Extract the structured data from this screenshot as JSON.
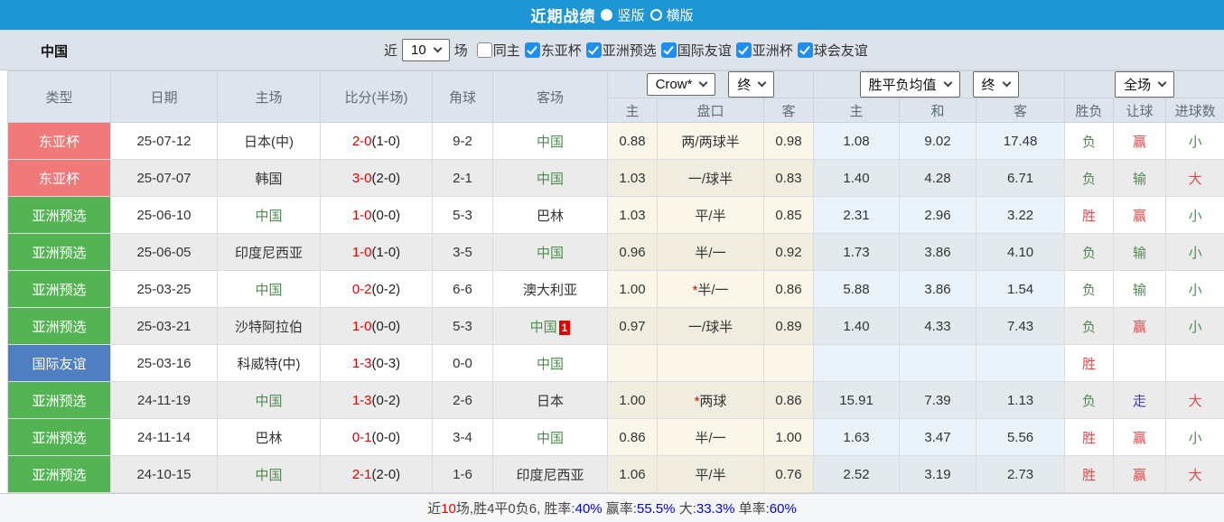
{
  "titlebar": {
    "title": "近期战绩",
    "radios": [
      {
        "label": "竖版",
        "selected": true
      },
      {
        "label": "横版",
        "selected": false
      }
    ]
  },
  "filters": {
    "team": "中国",
    "near_label": "近",
    "count": "10",
    "games_label": "场",
    "checkboxes": [
      {
        "label": "同主",
        "checked": false
      },
      {
        "label": "东亚杯",
        "checked": true
      },
      {
        "label": "亚洲预选",
        "checked": true
      },
      {
        "label": "国际友谊",
        "checked": true
      },
      {
        "label": "亚洲杯",
        "checked": true
      },
      {
        "label": "球会友谊",
        "checked": true
      }
    ]
  },
  "table": {
    "main_headers": [
      "类型",
      "日期",
      "主场",
      "比分(半场)",
      "角球",
      "客场"
    ],
    "sub_headers": [
      "主",
      "盘口",
      "客",
      "主",
      "和",
      "客",
      "胜负",
      "让球",
      "进球数"
    ],
    "selects": {
      "odds_source": "Crow*",
      "odds_time": "终",
      "wdl_avg": "胜平负均值",
      "wdl_time": "终",
      "scope": "全场"
    },
    "rows": [
      {
        "league": "东亚杯",
        "league_color": "red",
        "date": "25-07-12",
        "home": "日本(中)",
        "home_hl": false,
        "score": "2-0",
        "half": "(1-0)",
        "corners": "9-2",
        "away": "中国",
        "away_hl": true,
        "away_badge": "",
        "az_home": "0.88",
        "handicap_star": false,
        "handicap": "两/两球半",
        "az_away": "0.98",
        "eu_home": "1.08",
        "eu_draw": "9.02",
        "eu_away": "17.48",
        "result": {
          "text": "负",
          "color": "green"
        },
        "handicap_result": {
          "text": "赢",
          "color": "red"
        },
        "goals": {
          "text": "小",
          "color": "green"
        }
      },
      {
        "league": "东亚杯",
        "league_color": "red",
        "date": "25-07-07",
        "home": "韩国",
        "home_hl": false,
        "score": "3-0",
        "half": "(2-0)",
        "corners": "2-1",
        "away": "中国",
        "away_hl": true,
        "away_badge": "",
        "az_home": "1.03",
        "handicap_star": false,
        "handicap": "一/球半",
        "az_away": "0.83",
        "eu_home": "1.40",
        "eu_draw": "4.28",
        "eu_away": "6.71",
        "result": {
          "text": "负",
          "color": "green"
        },
        "handicap_result": {
          "text": "输",
          "color": "green"
        },
        "goals": {
          "text": "大",
          "color": "red"
        }
      },
      {
        "league": "亚洲预选",
        "league_color": "green",
        "date": "25-06-10",
        "home": "中国",
        "home_hl": true,
        "score": "1-0",
        "half": "(0-0)",
        "corners": "5-3",
        "away": "巴林",
        "away_hl": false,
        "away_badge": "",
        "az_home": "1.03",
        "handicap_star": false,
        "handicap": "平/半",
        "az_away": "0.85",
        "eu_home": "2.31",
        "eu_draw": "2.96",
        "eu_away": "3.22",
        "result": {
          "text": "胜",
          "color": "red"
        },
        "handicap_result": {
          "text": "赢",
          "color": "red"
        },
        "goals": {
          "text": "小",
          "color": "green"
        }
      },
      {
        "league": "亚洲预选",
        "league_color": "green",
        "date": "25-06-05",
        "home": "印度尼西亚",
        "home_hl": false,
        "score": "1-0",
        "half": "(1-0)",
        "corners": "3-5",
        "away": "中国",
        "away_hl": true,
        "away_badge": "",
        "az_home": "0.96",
        "handicap_star": false,
        "handicap": "半/一",
        "az_away": "0.92",
        "eu_home": "1.73",
        "eu_draw": "3.86",
        "eu_away": "4.10",
        "result": {
          "text": "负",
          "color": "green"
        },
        "handicap_result": {
          "text": "输",
          "color": "green"
        },
        "goals": {
          "text": "小",
          "color": "green"
        }
      },
      {
        "league": "亚洲预选",
        "league_color": "green",
        "date": "25-03-25",
        "home": "中国",
        "home_hl": true,
        "score": "0-2",
        "half": "(0-2)",
        "corners": "6-6",
        "away": "澳大利亚",
        "away_hl": false,
        "away_badge": "",
        "az_home": "1.00",
        "handicap_star": true,
        "handicap": "半/一",
        "az_away": "0.86",
        "eu_home": "5.88",
        "eu_draw": "3.86",
        "eu_away": "1.54",
        "result": {
          "text": "负",
          "color": "green"
        },
        "handicap_result": {
          "text": "输",
          "color": "green"
        },
        "goals": {
          "text": "小",
          "color": "green"
        }
      },
      {
        "league": "亚洲预选",
        "league_color": "green",
        "date": "25-03-21",
        "home": "沙特阿拉伯",
        "home_hl": false,
        "score": "1-0",
        "half": "(0-0)",
        "corners": "5-3",
        "away": "中国",
        "away_hl": true,
        "away_badge": "1",
        "az_home": "0.97",
        "handicap_star": false,
        "handicap": "一/球半",
        "az_away": "0.89",
        "eu_home": "1.40",
        "eu_draw": "4.33",
        "eu_away": "7.43",
        "result": {
          "text": "负",
          "color": "green"
        },
        "handicap_result": {
          "text": "赢",
          "color": "red"
        },
        "goals": {
          "text": "小",
          "color": "green"
        }
      },
      {
        "league": "国际友谊",
        "league_color": "blue",
        "date": "25-03-16",
        "home": "科威特(中)",
        "home_hl": false,
        "score": "1-3",
        "half": "(0-3)",
        "corners": "0-0",
        "away": "中国",
        "away_hl": true,
        "away_badge": "",
        "az_home": "",
        "handicap_star": false,
        "handicap": "",
        "az_away": "",
        "eu_home": "",
        "eu_draw": "",
        "eu_away": "",
        "result": {
          "text": "胜",
          "color": "red"
        },
        "handicap_result": {
          "text": "",
          "color": "dark"
        },
        "goals": {
          "text": "",
          "color": "dark"
        }
      },
      {
        "league": "亚洲预选",
        "league_color": "green",
        "date": "24-11-19",
        "home": "中国",
        "home_hl": true,
        "score": "1-3",
        "half": "(0-2)",
        "corners": "2-6",
        "away": "日本",
        "away_hl": false,
        "away_badge": "",
        "az_home": "1.00",
        "handicap_star": true,
        "handicap": "两球",
        "az_away": "0.86",
        "eu_home": "15.91",
        "eu_draw": "7.39",
        "eu_away": "1.13",
        "result": {
          "text": "负",
          "color": "green"
        },
        "handicap_result": {
          "text": "走",
          "color": "blue"
        },
        "goals": {
          "text": "大",
          "color": "red"
        }
      },
      {
        "league": "亚洲预选",
        "league_color": "green",
        "date": "24-11-14",
        "home": "巴林",
        "home_hl": false,
        "score": "0-1",
        "half": "(0-0)",
        "corners": "3-4",
        "away": "中国",
        "away_hl": true,
        "away_badge": "",
        "az_home": "0.86",
        "handicap_star": false,
        "handicap": "半/一",
        "az_away": "1.00",
        "eu_home": "1.63",
        "eu_draw": "3.47",
        "eu_away": "5.56",
        "result": {
          "text": "胜",
          "color": "red"
        },
        "handicap_result": {
          "text": "赢",
          "color": "red"
        },
        "goals": {
          "text": "小",
          "color": "green"
        }
      },
      {
        "league": "亚洲预选",
        "league_color": "green",
        "date": "24-10-15",
        "home": "中国",
        "home_hl": true,
        "score": "2-1",
        "half": "(2-0)",
        "corners": "1-6",
        "away": "印度尼西亚",
        "away_hl": false,
        "away_badge": "",
        "az_home": "1.06",
        "handicap_star": false,
        "handicap": "平/半",
        "az_away": "0.76",
        "eu_home": "2.52",
        "eu_draw": "3.19",
        "eu_away": "2.73",
        "result": {
          "text": "胜",
          "color": "red"
        },
        "handicap_result": {
          "text": "赢",
          "color": "red"
        },
        "goals": {
          "text": "大",
          "color": "red"
        }
      }
    ]
  },
  "footer": {
    "segments": [
      {
        "text": "近",
        "color": "dark"
      },
      {
        "text": "10",
        "color": "scarlet"
      },
      {
        "text": "场,胜4平0负6, 胜率:",
        "color": "dark"
      },
      {
        "text": "40%",
        "color": "link"
      },
      {
        "text": " 赢率:",
        "color": "dark"
      },
      {
        "text": "55.5%",
        "color": "link"
      },
      {
        "text": " 大:",
        "color": "dark"
      },
      {
        "text": "33.3%",
        "color": "link"
      },
      {
        "text": " 单率:",
        "color": "dark"
      },
      {
        "text": "60%",
        "color": "link"
      }
    ]
  },
  "palette": {
    "accent_blue": "#1e96d5",
    "league_red": "#f07a7a",
    "league_green": "#54b454",
    "league_blue": "#4f7fc0",
    "china_green": "#4e8c4e",
    "score_red": "#e60000",
    "result_red": "#dd4b4b",
    "result_green": "#4e8c4e",
    "result_blue": "#3a3ad0",
    "link_blue": "#0000e8",
    "text_dark": "#444444",
    "checkbox_blue": "#1e8ff0",
    "row_alt_gray": "#ebebeb",
    "odds_cream": "#fbf6ea",
    "wdl_blue_bg": "#e9f3f9"
  }
}
